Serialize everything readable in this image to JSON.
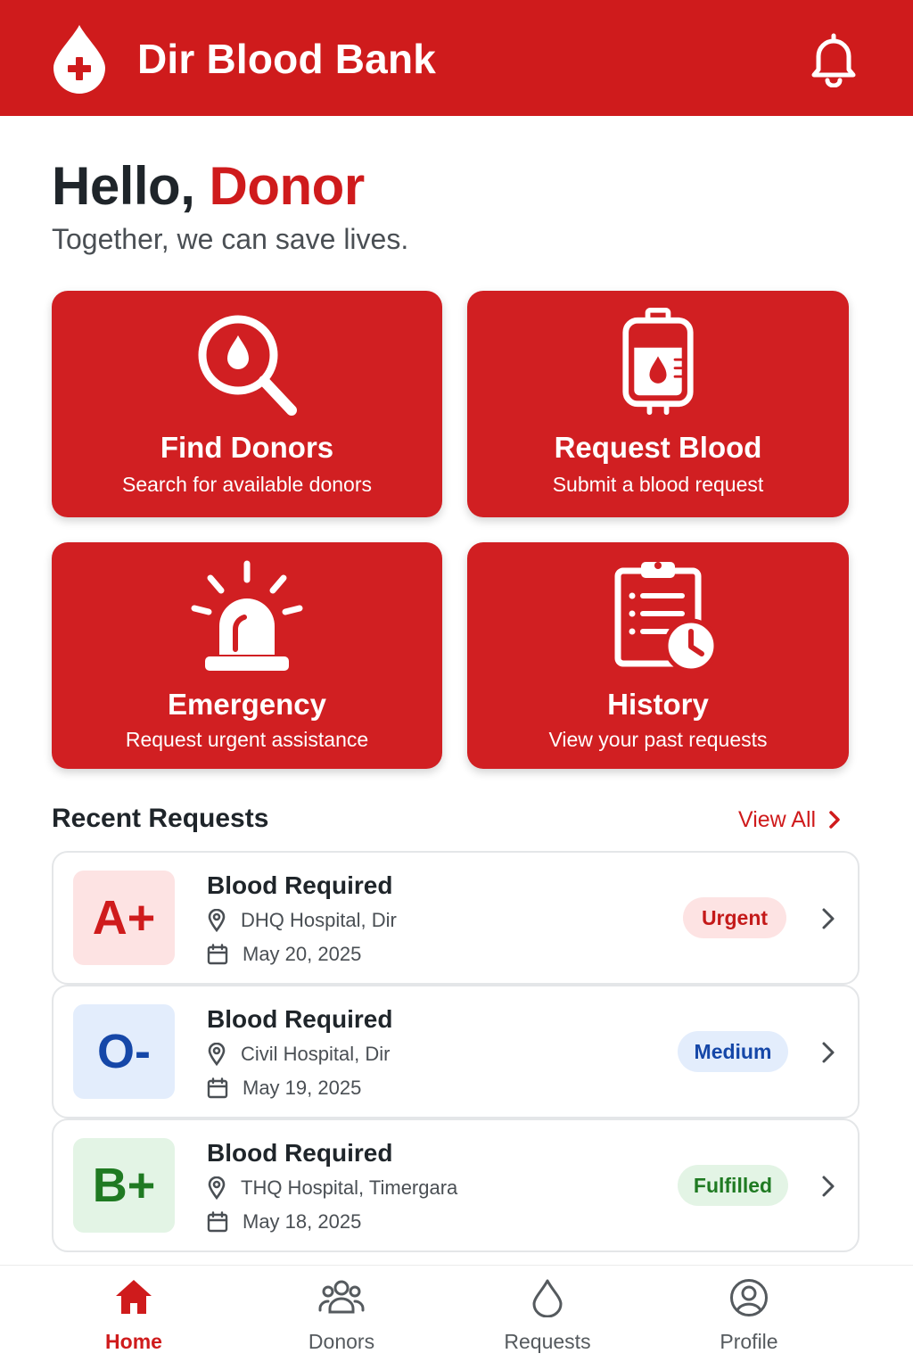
{
  "header": {
    "title": "Dir Blood Bank",
    "logo_icon": "blood-drop-plus-icon",
    "notification_icon": "bell-icon"
  },
  "greeting": {
    "hello": "Hello, ",
    "name": "Donor",
    "tagline": "Together, we can save lives."
  },
  "tiles": [
    {
      "title": "Find Donors",
      "subtitle": "Search for available donors",
      "icon": "search-drop-icon"
    },
    {
      "title": "Request Blood",
      "subtitle": "Submit a blood request",
      "icon": "blood-bag-icon"
    },
    {
      "title": "Emergency",
      "subtitle": "Request urgent assistance",
      "icon": "siren-icon"
    },
    {
      "title": "History",
      "subtitle": "View your past requests",
      "icon": "clipboard-clock-icon"
    }
  ],
  "recent": {
    "title": "Recent Requests",
    "view_all": "View All",
    "items": [
      {
        "blood_type": "A+",
        "title": "Blood Required",
        "location": "DHQ Hospital, Dir",
        "date": "May 20, 2025",
        "status": "Urgent"
      },
      {
        "blood_type": "O-",
        "title": "Blood Required",
        "location": "Civil Hospital, Dir",
        "date": "May 19, 2025",
        "status": "Medium"
      },
      {
        "blood_type": "B+",
        "title": "Blood Required",
        "location": "THQ Hospital, Timergara",
        "date": "May 18, 2025",
        "status": "Fulfilled"
      }
    ]
  },
  "nav": {
    "items": [
      {
        "label": "Home",
        "icon": "home-icon",
        "active": true
      },
      {
        "label": "Donors",
        "icon": "users-icon"
      },
      {
        "label": "Requests",
        "icon": "drop-icon"
      },
      {
        "label": "Profile",
        "icon": "profile-icon"
      }
    ]
  },
  "colors": {
    "brand_red": "#cf1b1c",
    "urgent_bg": "#fde3e3",
    "urgent_text": "#c41a1a",
    "medium_bg": "#e3edfc",
    "medium_text": "#1547a8",
    "fulfilled_bg": "#e3f4e5",
    "fulfilled_text": "#1f7a22"
  }
}
